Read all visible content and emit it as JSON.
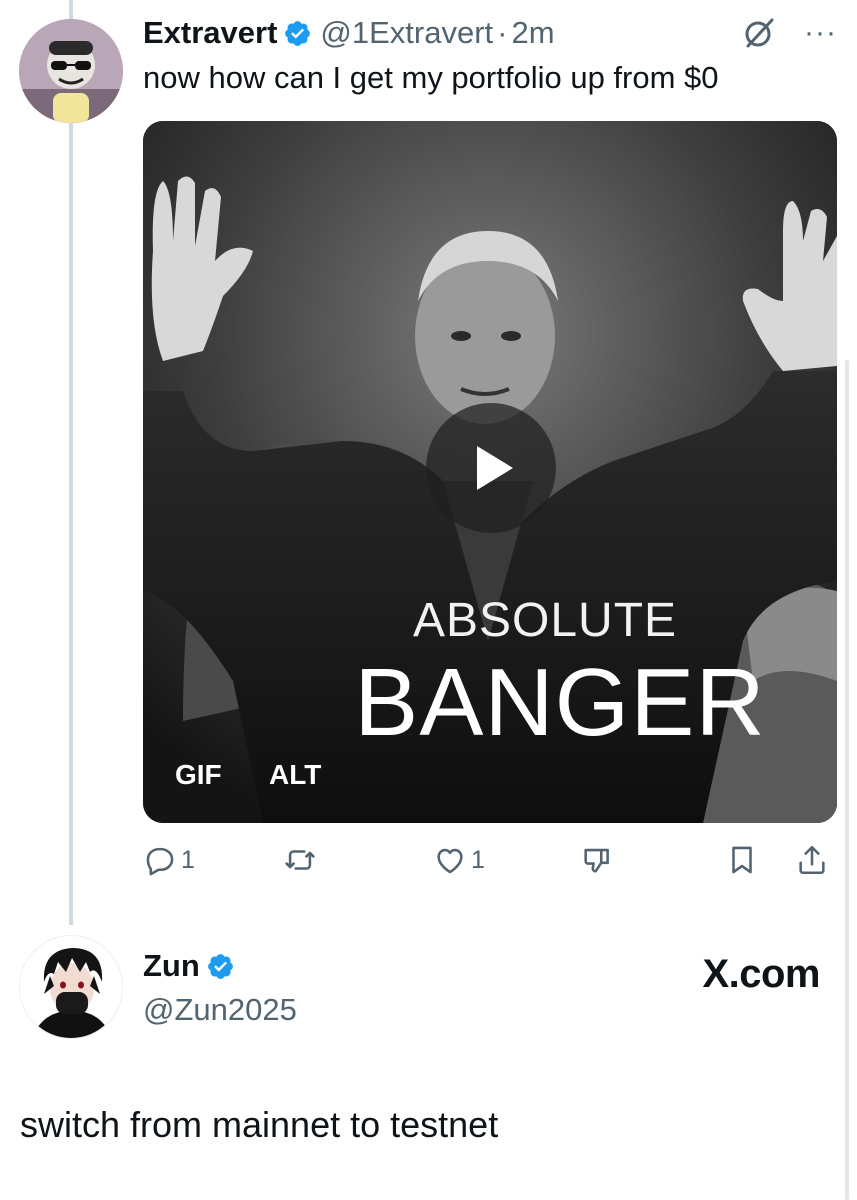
{
  "tweet1": {
    "display_name": "Extravert",
    "handle": "@1Extravert",
    "separator": "·",
    "time": "2m",
    "text": "now how can I get my portfolio up from $0",
    "media": {
      "caption_top": "ABSOLUTE",
      "caption_bottom": "BANGER",
      "badge_gif": "GIF",
      "badge_alt": "ALT"
    },
    "actions": {
      "reply_count": "1",
      "like_count": "1"
    }
  },
  "tweet2": {
    "display_name": "Zun",
    "handle": "@Zun2025",
    "watermark": "X.com",
    "text": "switch from mainnet to testnet"
  },
  "icons": {
    "verified": "verified-badge-icon",
    "grok": "grok-icon",
    "more": "more-icon",
    "play": "play-icon",
    "reply": "reply-icon",
    "retweet": "retweet-icon",
    "like": "heart-icon",
    "dislike": "dislike-icon",
    "bookmark": "bookmark-icon",
    "share": "share-icon"
  },
  "colors": {
    "verified_blue": "#1d9bf0",
    "muted_text": "#536471",
    "primary_text": "#0f1419"
  }
}
